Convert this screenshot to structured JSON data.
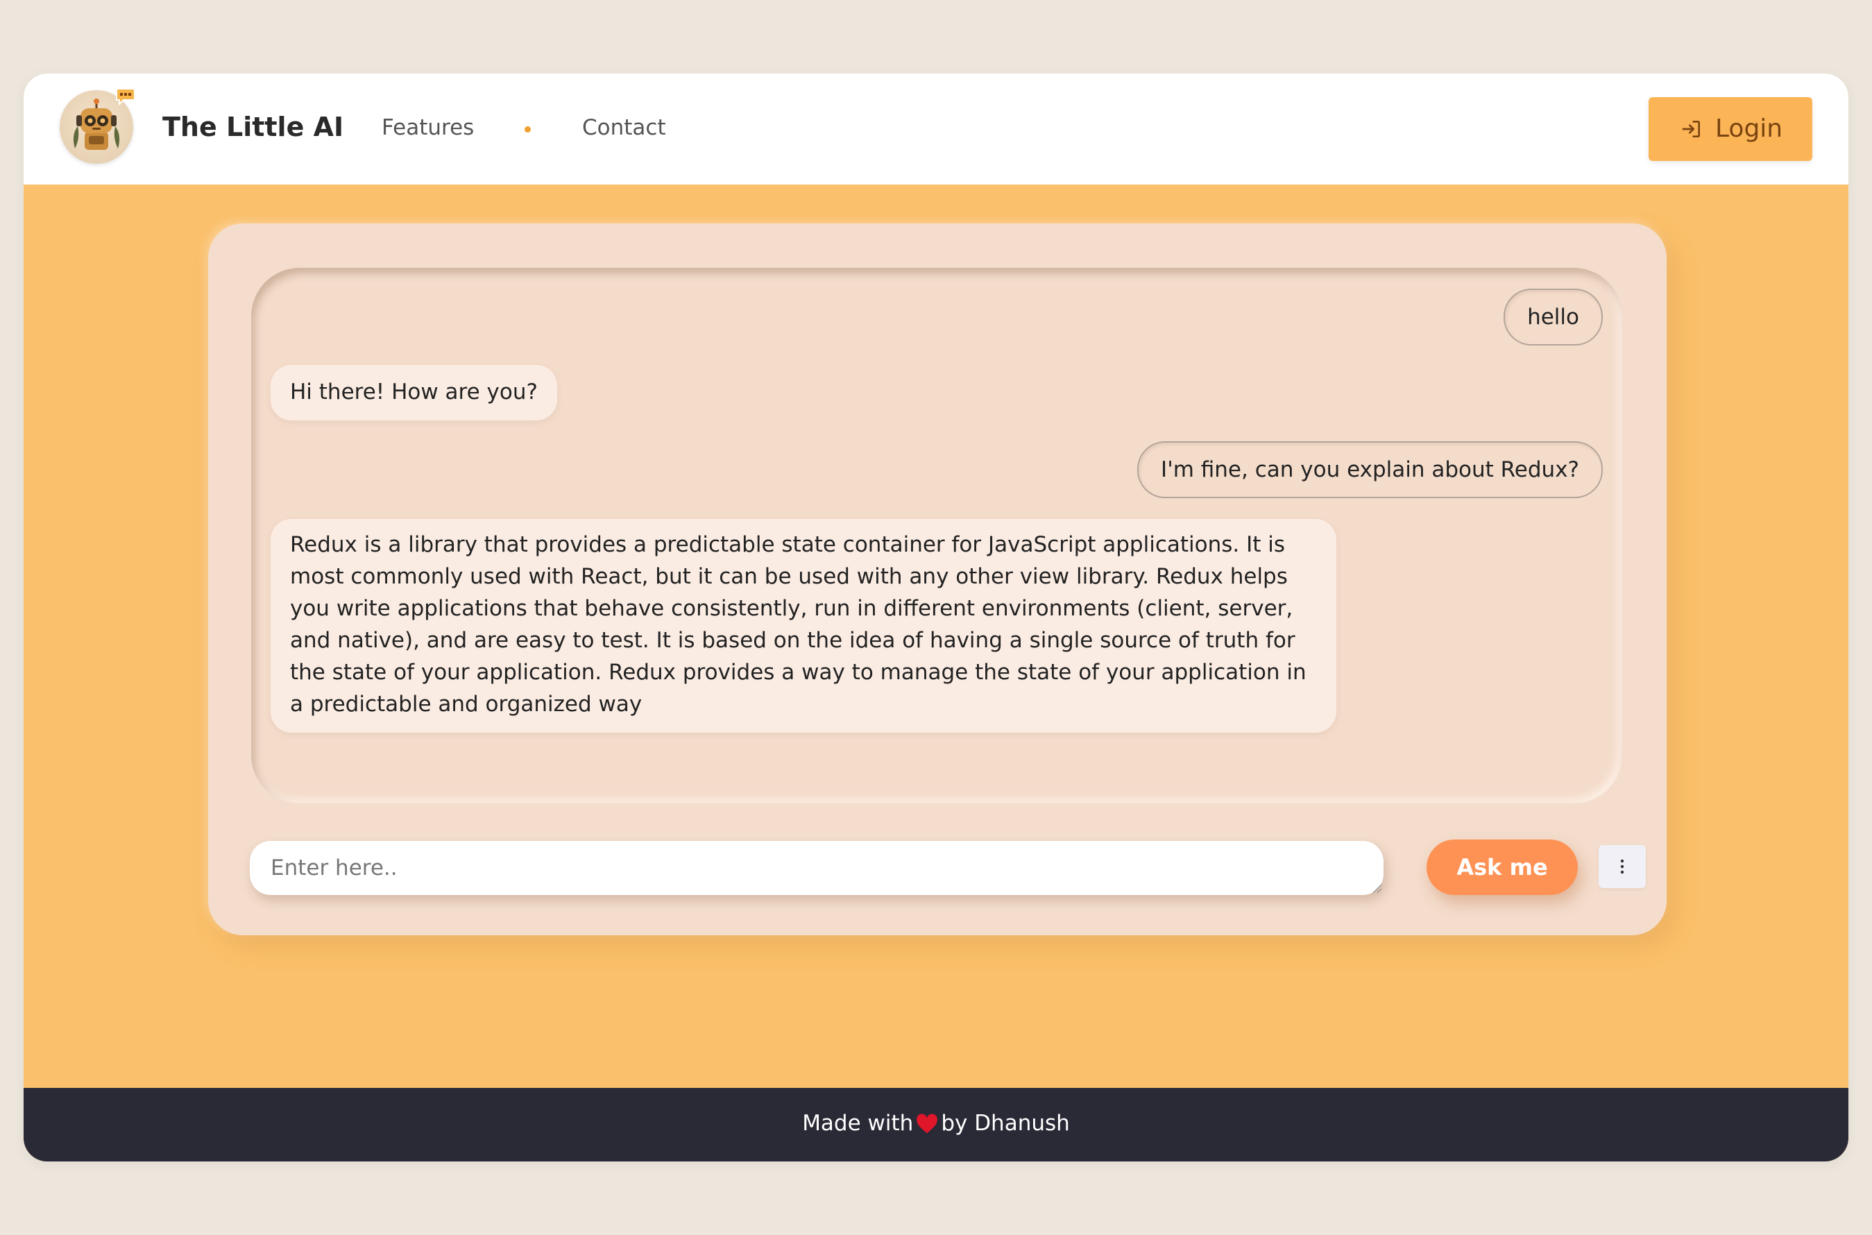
{
  "header": {
    "brand": "The Little AI",
    "nav": [
      {
        "label": "Features"
      },
      {
        "label": "Contact"
      }
    ],
    "login_label": "Login"
  },
  "chat": {
    "messages": [
      {
        "role": "user",
        "text": "hello"
      },
      {
        "role": "ai",
        "text": "Hi there! How are you?"
      },
      {
        "role": "user",
        "text": "I'm fine, can you explain about Redux?"
      },
      {
        "role": "ai",
        "text": "Redux is a library that provides a predictable state container for JavaScript applications. It is most commonly used with React, but it can be used with any other view library. Redux helps you write applications that behave consistently, run in different environments (client, server, and native), and are easy to test. It is based on the idea of having a single source of truth for the state of your application. Redux provides a way to manage the state of your application in a predictable and organized way"
      }
    ],
    "input_placeholder": "Enter here..",
    "ask_label": "Ask me"
  },
  "footer": {
    "made_with": "Made with",
    "by": "by Dhanush"
  },
  "colors": {
    "page_bg": "#ede6dc",
    "app_bg": "#fbc06b",
    "panel_bg": "#f4ddcc",
    "login_bg": "#fbb456",
    "ask_bg": "#fd9254",
    "footer_bg": "#2a2936",
    "heart": "#e0162b"
  },
  "icons": {
    "logo": "robot-avatar-icon",
    "login": "login-arrow-icon",
    "menu": "vertical-dots-icon",
    "heart": "heart-icon"
  }
}
